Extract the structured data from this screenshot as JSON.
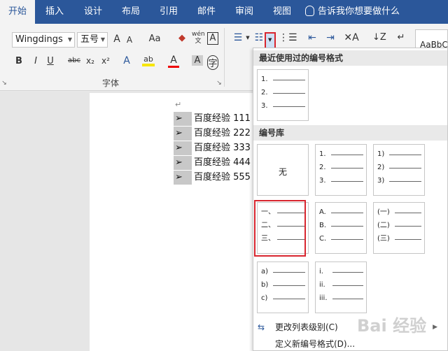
{
  "tabs": [
    "开始",
    "插入",
    "设计",
    "布局",
    "引用",
    "邮件",
    "审阅",
    "视图"
  ],
  "tell_me": "告诉我你想要做什么",
  "ribbon": {
    "font_name": "Wingdings",
    "font_size": "五号",
    "font_group_label": "字体",
    "style_preview": "AaBbC"
  },
  "document": {
    "lines": [
      "百度经验 111",
      "百度经验 222",
      "百度经验 333",
      "百度经验 444",
      "百度经验 555"
    ],
    "bullet_glyph": "➢"
  },
  "panel": {
    "recent_header": "最近使用过的编号格式",
    "library_header": "编号库",
    "recent_tile": [
      "1.",
      "2.",
      "3."
    ],
    "none_label": "无",
    "library_tiles": [
      [
        "1.",
        "2.",
        "3."
      ],
      [
        "1)",
        "2)",
        "3)"
      ],
      [
        "一、",
        "二、",
        "三、"
      ],
      [
        "A.",
        "B.",
        "C."
      ],
      [
        "(一)",
        "(二)",
        "(三)"
      ],
      [
        "a)",
        "b)",
        "c)"
      ],
      [
        "i.",
        "ii.",
        "iii."
      ]
    ],
    "menu": {
      "change_level": "更改列表级别(C)",
      "define_new": "定义新编号格式(D)..."
    }
  },
  "watermark": "Bai 经验",
  "colors": {
    "accent": "#2b579a",
    "highlight_red": "#d8262f"
  }
}
